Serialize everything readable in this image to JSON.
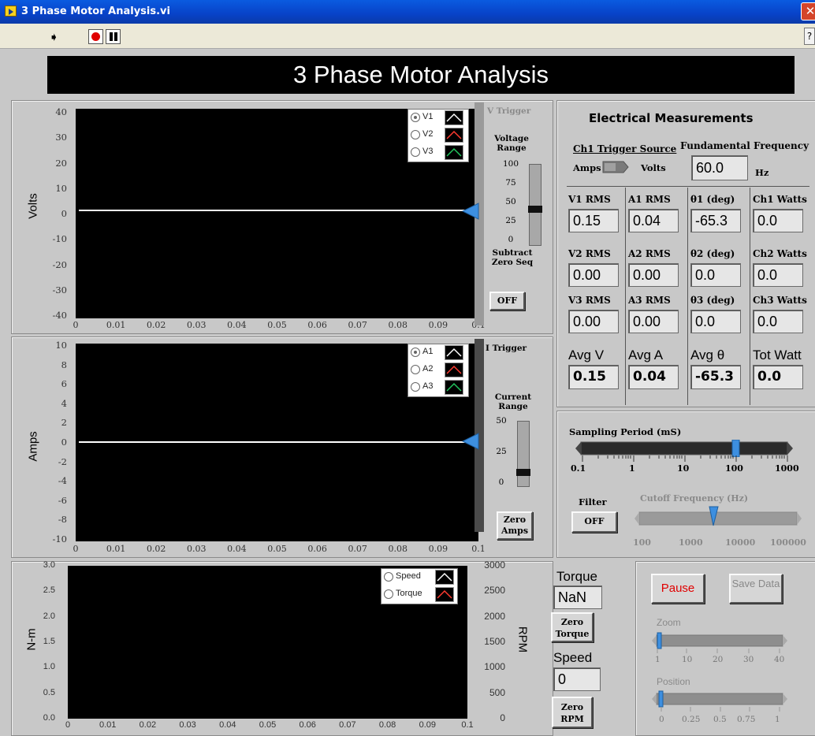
{
  "window": {
    "title": "3 Phase Motor Analysis.vi",
    "close_glyph": "✕",
    "help_glyph": "?"
  },
  "toolbar": {
    "run_glyph": "➧"
  },
  "banner": {
    "title": "3 Phase Motor Analysis"
  },
  "voltage_chart": {
    "ylabel": "Volts",
    "yticks": [
      "40",
      "30",
      "20",
      "10",
      "0",
      "-10",
      "-20",
      "-30",
      "-40"
    ],
    "xticks": [
      "0",
      "0.01",
      "0.02",
      "0.03",
      "0.04",
      "0.05",
      "0.06",
      "0.07",
      "0.08",
      "0.09",
      "0.1"
    ],
    "legend": [
      {
        "name": "V1",
        "selected": true,
        "color": "#ffffff"
      },
      {
        "name": "V2",
        "selected": false,
        "color": "#ff3b30"
      },
      {
        "name": "V3",
        "selected": false,
        "color": "#22c55e"
      }
    ],
    "trigger_label": "V Trigger",
    "range_label": "Voltage Range",
    "range_scale": [
      "100",
      "75",
      "50",
      "25",
      "0"
    ],
    "range_value": 45,
    "subtract_label": "Subtract Zero Seq",
    "subtract_button": "OFF"
  },
  "current_chart": {
    "ylabel": "Amps",
    "yticks": [
      "10",
      "8",
      "6",
      "4",
      "2",
      "0",
      "-2",
      "-4",
      "-6",
      "-8",
      "-10"
    ],
    "xticks": [
      "0",
      "0.01",
      "0.02",
      "0.03",
      "0.04",
      "0.05",
      "0.06",
      "0.07",
      "0.08",
      "0.09",
      "0.1"
    ],
    "legend": [
      {
        "name": "A1",
        "selected": true,
        "color": "#ffffff"
      },
      {
        "name": "A2",
        "selected": false,
        "color": "#ff3b30"
      },
      {
        "name": "A3",
        "selected": false,
        "color": "#22c55e"
      }
    ],
    "trigger_label": "I Trigger",
    "range_label": "Current Range",
    "range_scale": [
      "50",
      "25",
      "0"
    ],
    "range_value": 6,
    "zero_button": "Zero Amps"
  },
  "mechanical_chart": {
    "ylabel_left": "N-m",
    "ylabel_right": "RPM",
    "yticks_left": [
      "3.0",
      "2.5",
      "2.0",
      "1.5",
      "1.0",
      "0.5",
      "0.0"
    ],
    "yticks_right": [
      "3000",
      "2500",
      "2000",
      "1500",
      "1000",
      "500",
      "0"
    ],
    "xticks": [
      "0",
      "0.01",
      "0.02",
      "0.03",
      "0.04",
      "0.05",
      "0.06",
      "0.07",
      "0.08",
      "0.09",
      "0.1"
    ],
    "legend": [
      {
        "name": "Speed",
        "selected": false,
        "color": "#ffffff"
      },
      {
        "name": "Torque",
        "selected": false,
        "color": "#ff3b30"
      }
    ]
  },
  "mechanical_controls": {
    "torque_label": "Torque",
    "torque_value": "NaN",
    "zero_torque": "Zero Torque",
    "speed_label": "Speed",
    "speed_value": "0",
    "zero_rpm": "Zero RPM"
  },
  "electrical": {
    "title": "Electrical Measurements",
    "trigger_source_label": "Ch1 Trigger Source",
    "trigger_left": "Amps",
    "trigger_right": "Volts",
    "freq_label": "Fundamental Frequency",
    "freq_value": "60.0",
    "freq_unit": "Hz",
    "rows": [
      {
        "headers": [
          "V1 RMS",
          "A1 RMS",
          "θ1 (deg)",
          "Ch1 Watts"
        ],
        "values": [
          "0.15",
          "0.04",
          "-65.3",
          "0.0"
        ]
      },
      {
        "headers": [
          "V2 RMS",
          "A2 RMS",
          "θ2 (deg)",
          "Ch2 Watts"
        ],
        "values": [
          "0.00",
          "0.00",
          "0.0",
          "0.0"
        ]
      },
      {
        "headers": [
          "V3 RMS",
          "A3 RMS",
          "θ3 (deg)",
          "Ch3 Watts"
        ],
        "values": [
          "0.00",
          "0.00",
          "0.0",
          "0.0"
        ]
      }
    ],
    "avg_headers": [
      "Avg V",
      "Avg A",
      "Avg θ",
      "Tot Watt"
    ],
    "avg_values": [
      "0.15",
      "0.04",
      "-65.3",
      "0.0"
    ]
  },
  "sampling": {
    "label": "Sampling Period (mS)",
    "scale": [
      "0.1",
      "1",
      "10",
      "100",
      "1000"
    ],
    "value": 100,
    "filter_label": "Filter",
    "filter_button": "OFF",
    "cutoff_label": "Cutoff Frequency (Hz)",
    "cutoff_scale": [
      "100",
      "1000",
      "10000",
      "100000"
    ]
  },
  "controls": {
    "pause_button": "Pause",
    "save_button": "Save Data",
    "zoom_label": "Zoom",
    "zoom_scale": [
      "1",
      "10",
      "20",
      "30",
      "40"
    ],
    "position_label": "Position",
    "position_scale": [
      "0",
      "0.25",
      "0.5",
      "0.75",
      "1"
    ]
  },
  "colors": {
    "plot_bg": "#000000",
    "panel_bg": "#c8c8c8",
    "pointer": "#3d8fe0",
    "pause_text": "#e00000"
  }
}
